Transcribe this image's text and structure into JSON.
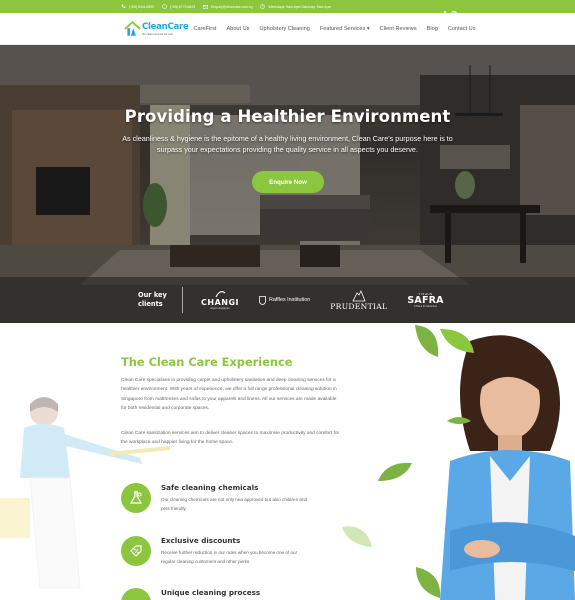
{
  "topbar": {
    "phone1": "(+65) 6344 8899",
    "whatsapp": "(+65) 8773 6653",
    "email": "Enquiry@cleancare.com.sg",
    "hours": "Weekdays: 9am-6pm  Saturday: 9am-1pm",
    "social": [
      "facebook-icon",
      "instagram-icon"
    ]
  },
  "nav": {
    "logo_name": "CleanCare",
    "logo_tagline": "We clean because we care",
    "items": [
      "CareFirst",
      "About Us",
      "Upholstery Cleaning",
      "Featured Services ▾",
      "Client Reviews",
      "Blog",
      "Contact Us"
    ]
  },
  "hero": {
    "title": "Providing a Healthier Environment",
    "subtitle": "As cleanliness & hygiene is the epitome of a healthy living environment, Clean Care's purpose here is to surpass your expectations providing the quality service in all aspects you deserve.",
    "cta": "Enquire Now",
    "clients_label": "Our key clients",
    "clients": {
      "changi_name": "CHANGI",
      "changi_sub": "airport singapore",
      "raffles": "Raffles Institution",
      "prudential": "PRUDENTIAL",
      "safra_top": "YISHUN",
      "safra_name": "SAFRA",
      "safra_sub": "A Place for Adventure"
    }
  },
  "experience": {
    "title": "The Clean Care Experience",
    "para1": "Clean Care specialises in providing carpet and upholstery sanitation and deep cleaning services for a healthier environment. With years of experience, we offer a full range professional cleaning solution in Singapore from mattresses and sofas to your apparels and linens. All our services are made available for both residential and corporate spaces.",
    "para2": "Clean Care sanitization services aim to deliver cleaner spaces to maximise productivity and comfort for the workplace and happier living for the home space.",
    "features": [
      {
        "title": "Safe cleaning chemicals",
        "desc": "Our cleaning chemicals are not only nea approved but also children and pets friendly"
      },
      {
        "title": "Exclusive discounts",
        "desc": "Receive further reduction in our rates when you become one of our regular cleaning customers and other perks"
      },
      {
        "title": "Unique cleaning process",
        "desc": ""
      }
    ]
  },
  "colors": {
    "brand_green": "#8cc63f",
    "logo_blue": "#25a7d8"
  }
}
